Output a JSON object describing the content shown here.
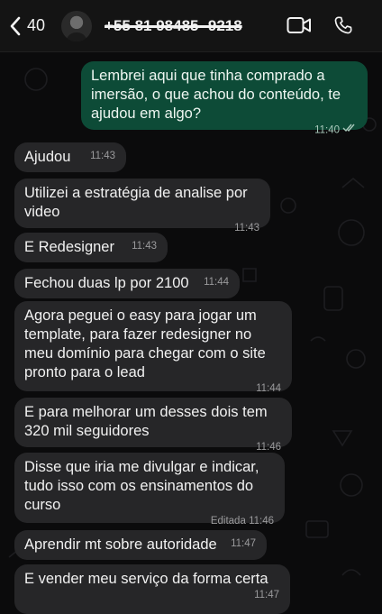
{
  "header": {
    "back_count": "40",
    "contact_name": "+55 81 98485 -9218",
    "icons": {
      "back": "chevron-left-icon",
      "video": "video-camera-icon",
      "call": "phone-icon"
    }
  },
  "messages": [
    {
      "direction": "out",
      "text": "Lembrei aqui que tinha comprado a imersão, o que achou do conteúdo, te ajudou em algo?",
      "time": "11:40",
      "read": true
    },
    {
      "direction": "in",
      "text": "Ajudou",
      "time": "11:43"
    },
    {
      "direction": "in",
      "text": "Utilizei a estratégia de analise por video",
      "time": "11:43"
    },
    {
      "direction": "in",
      "text": "E Redesigner",
      "time": "11:43"
    },
    {
      "direction": "in",
      "text": "Fechou duas lp por 2100",
      "time": "11:44"
    },
    {
      "direction": "in",
      "text": "Agora peguei o easy para jogar um template, para fazer redesigner no meu domínio para chegar com o site pronto para o lead",
      "time": "11:44"
    },
    {
      "direction": "in",
      "text": "E para melhorar um desses dois tem 320 mil seguidores",
      "time": "11:46"
    },
    {
      "direction": "in",
      "text": "Disse que iria me divulgar e indicar, tudo isso com os ensinamentos do curso",
      "time": "11:46",
      "edited_label": "Editada"
    },
    {
      "direction": "in",
      "text": "Aprendir mt sobre autoridade",
      "time": "11:47"
    },
    {
      "direction": "in",
      "text": "E vender meu serviço da forma certa",
      "time": "11:47"
    }
  ],
  "colors": {
    "incoming_bubble": "#262628",
    "outgoing_bubble": "#0d4b37",
    "read_ticks": "#a9c9bb"
  }
}
